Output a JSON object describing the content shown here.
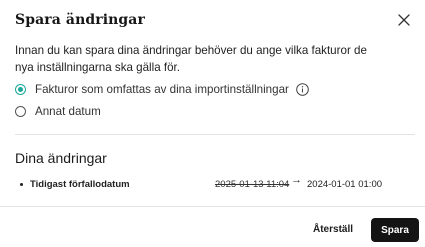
{
  "dialog": {
    "title": "Spara ändringar",
    "intro_text": "Innan du kan spara dina ändringar behöver du ange vilka fakturor de nya inställningarna ska gälla för.",
    "options": [
      {
        "label": "Fakturor som omfattas av dina importinställningar",
        "selected": true
      },
      {
        "label": "Annat datum",
        "selected": false
      }
    ],
    "changes_title": "Dina ändringar",
    "changes": [
      {
        "field": "Tidigast förfallodatum",
        "old_value": "2025-01-13 11:04",
        "arrow": "→",
        "new_value": "2024-01-01 01:00"
      }
    ],
    "buttons": {
      "reset_label": "Återställ",
      "save_label": "Spara"
    },
    "colors": {
      "accent": "#1aa89a",
      "primary_button": "#141414"
    },
    "icons": {
      "close": "close-icon",
      "info": "info-icon"
    }
  }
}
